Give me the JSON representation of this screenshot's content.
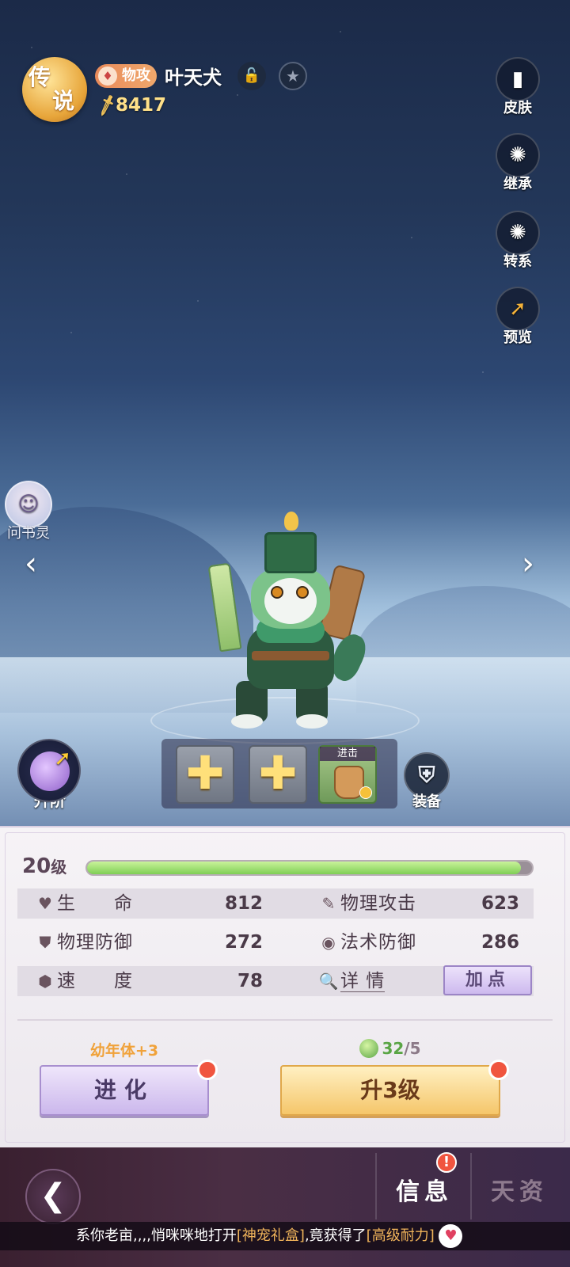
{
  "header": {
    "rank_badge_line1": "传",
    "rank_badge_line2": "说",
    "type_label": "物攻",
    "pet_name": "叶天犬",
    "power_value": "8417"
  },
  "side_buttons": {
    "skin": "皮肤",
    "inherit": "继承",
    "transfer": "转系",
    "preview": "预览"
  },
  "helper_label": "问书灵",
  "upgrade_rank_label": "升阶",
  "skill_slots": {
    "slot3_tag": "进击"
  },
  "equip_label": "装备",
  "stats": {
    "level_number": "20",
    "level_unit": "级",
    "exp_fraction": 0.975,
    "hp_label": "生　　命",
    "hp_value": "812",
    "patk_label": "物理攻击",
    "patk_value": "623",
    "pdef_label": "物理防御",
    "pdef_value": "272",
    "mdef_label": "法术防御",
    "mdef_value": "286",
    "speed_label": "速　　度",
    "speed_value": "78",
    "detail_label": "详 情",
    "addpoint_label": "加点"
  },
  "actions": {
    "evolve_note": "幼年体+3",
    "evolve_label": "进化",
    "levelup_have": "32",
    "levelup_need": "/5",
    "levelup_label": "升3级"
  },
  "bottom_nav": {
    "tab_info": "信息",
    "tab_talent": "天资",
    "alert_mark": "!"
  },
  "ticker": {
    "prefix": "系你老亩,,,,悄咪咪地打开",
    "item1": "[神宠礼盒]",
    "middle": ",竟获得了",
    "item2": "[高级耐力]"
  }
}
